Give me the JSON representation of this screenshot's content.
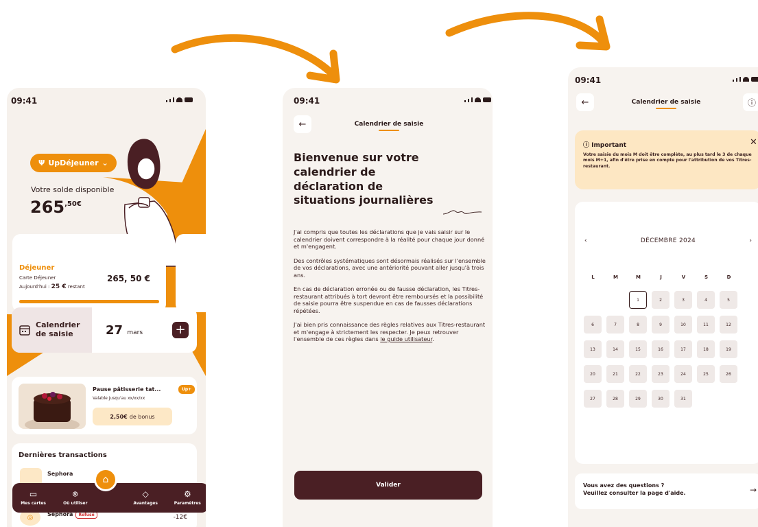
{
  "colors": {
    "accent": "#ee8f0c",
    "dark": "#4a1f24",
    "cream": "#fde7c3"
  },
  "status": {
    "time": "09:41"
  },
  "screen1": {
    "brand_pill": "UpDéjeuner",
    "balance_label": "Votre solde disponible",
    "balance_main": "265",
    "balance_cents": ",50€",
    "meal_card": {
      "title": "Déjeuner",
      "subtitle": "Carte Déjeuner",
      "today_label": "Aujourd'hui :",
      "today_value": "25 €",
      "today_suffix": "restant",
      "amount": "265, 50 €",
      "progress": 1.0
    },
    "calendar_card": {
      "label": "Calendrier de saisie",
      "day": "27",
      "month": "mars",
      "add": "+"
    },
    "promo": {
      "title": "Pause pâtisserie tat...",
      "validity": "Valable jusqu'au xx/xx/xx",
      "badge": "Up+",
      "bonus_value": "2,50€",
      "bonus_label": "de bonus"
    },
    "transactions": {
      "title": "Dernières transactions",
      "items": [
        {
          "name": "Sephora",
          "amount": ""
        },
        {
          "name": "Sephora",
          "status": "Refusé",
          "amount": "-12€"
        }
      ]
    },
    "tabbar": [
      {
        "label": "Mes cartes",
        "icon": "card-icon"
      },
      {
        "label": "Où utiliser",
        "icon": "map-pin-icon"
      },
      {
        "label": "Avantages",
        "icon": "tag-icon"
      },
      {
        "label": "Paramètres",
        "icon": "gear-icon"
      }
    ],
    "home_icon": "home-icon"
  },
  "screen2": {
    "nav_title": "Calendrier de saisie",
    "heading": "Bienvenue sur votre calendrier de déclaration de situations journalières",
    "paragraphs": [
      "J'ai compris que toutes les déclarations que je vais saisir sur le calendrier doivent correspondre à la réalité pour chaque jour donné et m'engagent.",
      "Des contrôles systématiques sont désormais réalisés sur l'ensemble de vos déclarations, avec une antériorité pouvant aller jusqu'à trois ans.",
      "En cas de déclaration erronée ou de fausse déclaration, les Titres-restaurant attribués à tort devront être remboursés et la possibilité de saisie pourra être suspendue en cas de fausses déclarations répétées."
    ],
    "last_paragraph_text": "J'ai bien pris connaissance des règles relatives aux Titres-restaurant et m'engage à strictement les respecter. Je peux retrouver l'ensemble de ces règles dans ",
    "last_paragraph_link": "le guide utilisateur",
    "last_paragraph_end": ".",
    "validate_button": "Valider"
  },
  "screen3": {
    "nav_title": "Calendrier de saisie",
    "important_title": "Important",
    "important_text": "Votre saisie du mois M doit être complète, au plus tard le 3 de chaque mois M+1, afin d'être prise en compte pour l'attribution de vos Titres-restaurant.",
    "month": "DÉCEMBRE 2024",
    "weekdays": [
      "L",
      "M",
      "M",
      "J",
      "V",
      "S",
      "D"
    ],
    "today": 1,
    "first_weekday_index": 2,
    "days_in_month": 31,
    "help_line1": "Vous avez des questions ?",
    "help_line2": "Veuillez consulter la page d'aide."
  }
}
